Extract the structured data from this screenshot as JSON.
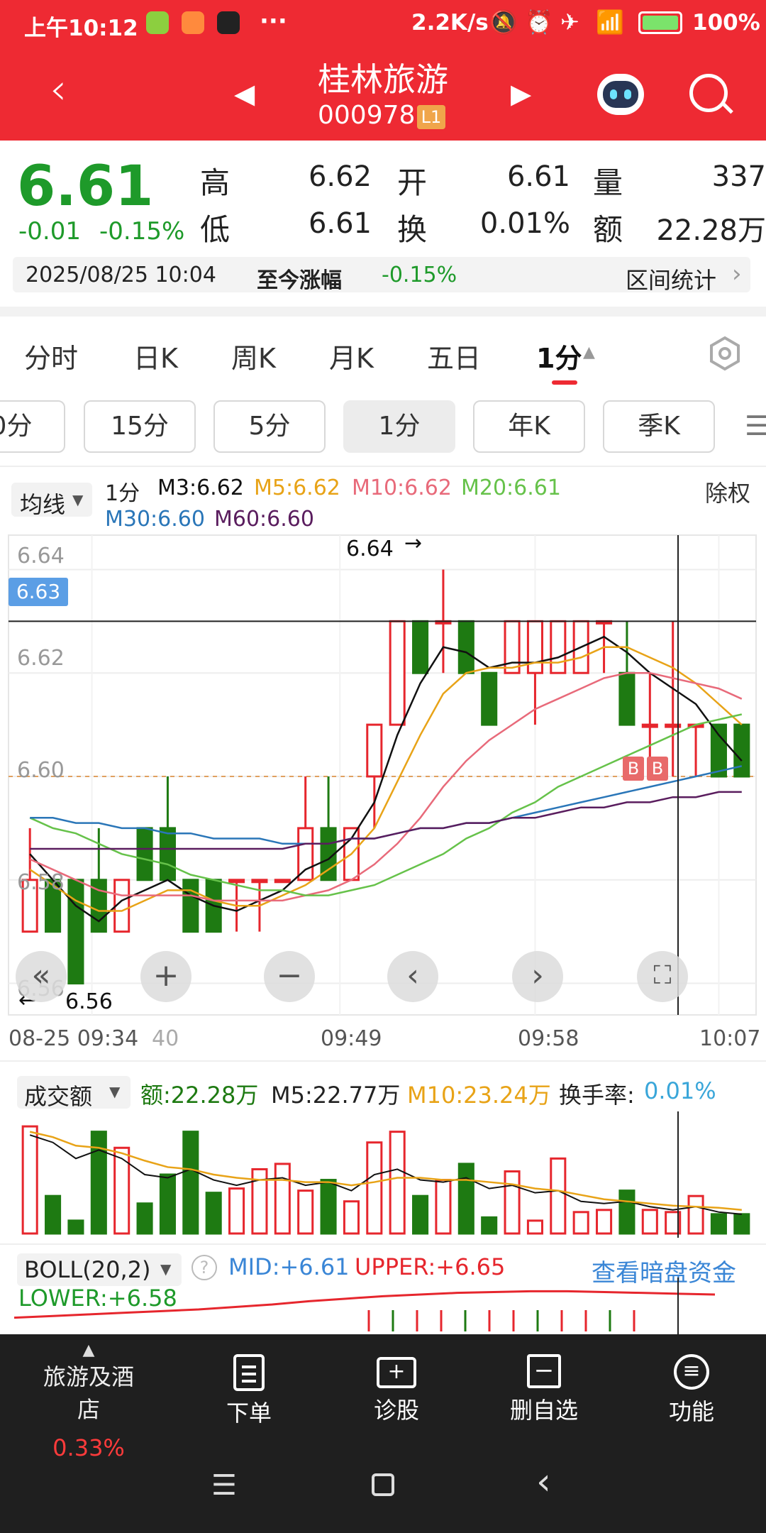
{
  "status_bar": {
    "time": "上午10:12",
    "net_speed": "2.2K/s",
    "battery": "100%"
  },
  "header": {
    "stock_name": "桂林旅游",
    "stock_code": "000978",
    "level_badge": "L1"
  },
  "quote": {
    "price": "6.61",
    "change": "-0.01",
    "change_pct": "-0.15%",
    "high_label": "高",
    "high": "6.62",
    "open_label": "开",
    "open": "6.61",
    "volume_label": "量",
    "volume": "337",
    "low_label": "低",
    "low": "6.61",
    "turnover_label": "换",
    "turnover": "0.01%",
    "amount_label": "额",
    "amount": "22.28万",
    "datetime": "2025/08/25 10:04",
    "since_label": "至今涨幅",
    "since_value": "-0.15%",
    "range_stats": "区间统计"
  },
  "tabs": [
    "分时",
    "日K",
    "周K",
    "月K",
    "五日",
    "1分"
  ],
  "period_buttons": [
    "0分",
    "15分",
    "5分",
    "1分",
    "年K",
    "季K"
  ],
  "ma_legend": {
    "selector": "均线",
    "period": "1分",
    "m3": "M3:6.62",
    "m5": "M5:6.62",
    "m10": "M10:6.62",
    "m20": "M20:6.61",
    "m30": "M30:6.60",
    "m60": "M60:6.60",
    "rights": "除权"
  },
  "main_chart_labels": {
    "y_ticks": [
      "6.64",
      "6.62",
      "6.60",
      "6.58",
      "6.56"
    ],
    "crosshair_price": "6.63",
    "high_marker": "6.64",
    "low_marker": "6.56",
    "x_ticks": [
      "08-25 09:34",
      "40",
      "09:49",
      "09:58",
      "10:07"
    ],
    "b_marks": [
      "B",
      "B"
    ]
  },
  "volume_legend": {
    "selector": "成交额",
    "amount": "额:22.28万",
    "m5": "M5:22.77万",
    "m10": "M10:23.24万",
    "turnover_label": "换手率:",
    "turnover_value": "0.01%"
  },
  "boll_legend": {
    "selector": "BOLL(20,2)",
    "mid": "MID:+6.61",
    "upper": "UPPER:+6.65",
    "lower": "LOWER:+6.58",
    "dark_pool": "查看暗盘资金"
  },
  "bottom_nav": {
    "sector": "旅游及酒店",
    "sector_change": "0.33%",
    "items": [
      "下单",
      "诊股",
      "删自选",
      "功能"
    ]
  },
  "colors": {
    "red": "#e6262d",
    "green": "#1e7a12",
    "header": "#ee2a33",
    "m5": "#e8a317",
    "m10": "#e86a7a",
    "m20": "#66c24a",
    "m30": "#2a76b8",
    "m60": "#5a1d5e"
  },
  "chart_data": {
    "type": "candlestick",
    "ylim": [
      6.555,
      6.645
    ],
    "candles": [
      {
        "o": 6.57,
        "c": 6.58,
        "h": 6.59,
        "l": 6.57
      },
      {
        "o": 6.58,
        "c": 6.57,
        "h": 6.58,
        "l": 6.57
      },
      {
        "o": 6.58,
        "c": 6.56,
        "h": 6.58,
        "l": 6.56
      },
      {
        "o": 6.58,
        "c": 6.57,
        "h": 6.59,
        "l": 6.57
      },
      {
        "o": 6.57,
        "c": 6.58,
        "h": 6.58,
        "l": 6.57
      },
      {
        "o": 6.59,
        "c": 6.58,
        "h": 6.59,
        "l": 6.58
      },
      {
        "o": 6.59,
        "c": 6.58,
        "h": 6.6,
        "l": 6.58
      },
      {
        "o": 6.58,
        "c": 6.57,
        "h": 6.58,
        "l": 6.57
      },
      {
        "o": 6.58,
        "c": 6.57,
        "h": 6.58,
        "l": 6.57
      },
      {
        "o": 6.58,
        "c": 6.58,
        "h": 6.58,
        "l": 6.57
      },
      {
        "o": 6.58,
        "c": 6.58,
        "h": 6.58,
        "l": 6.57
      },
      {
        "o": 6.58,
        "c": 6.58,
        "h": 6.58,
        "l": 6.58
      },
      {
        "o": 6.58,
        "c": 6.59,
        "h": 6.6,
        "l": 6.58
      },
      {
        "o": 6.59,
        "c": 6.58,
        "h": 6.6,
        "l": 6.58
      },
      {
        "o": 6.58,
        "c": 6.59,
        "h": 6.59,
        "l": 6.58
      },
      {
        "o": 6.6,
        "c": 6.61,
        "h": 6.61,
        "l": 6.59
      },
      {
        "o": 6.61,
        "c": 6.63,
        "h": 6.63,
        "l": 6.61
      },
      {
        "o": 6.63,
        "c": 6.62,
        "h": 6.63,
        "l": 6.62
      },
      {
        "o": 6.63,
        "c": 6.63,
        "h": 6.64,
        "l": 6.62
      },
      {
        "o": 6.63,
        "c": 6.62,
        "h": 6.63,
        "l": 6.62
      },
      {
        "o": 6.62,
        "c": 6.61,
        "h": 6.62,
        "l": 6.61
      },
      {
        "o": 6.62,
        "c": 6.63,
        "h": 6.63,
        "l": 6.62
      },
      {
        "o": 6.62,
        "c": 6.63,
        "h": 6.63,
        "l": 6.61
      },
      {
        "o": 6.62,
        "c": 6.63,
        "h": 6.63,
        "l": 6.62
      },
      {
        "o": 6.62,
        "c": 6.63,
        "h": 6.63,
        "l": 6.62
      },
      {
        "o": 6.63,
        "c": 6.63,
        "h": 6.63,
        "l": 6.62
      },
      {
        "o": 6.62,
        "c": 6.61,
        "h": 6.63,
        "l": 6.61
      },
      {
        "o": 6.61,
        "c": 6.61,
        "h": 6.62,
        "l": 6.6
      },
      {
        "o": 6.61,
        "c": 6.61,
        "h": 6.63,
        "l": 6.6
      },
      {
        "o": 6.61,
        "c": 6.61,
        "h": 6.61,
        "l": 6.6
      },
      {
        "o": 6.61,
        "c": 6.6,
        "h": 6.61,
        "l": 6.6
      },
      {
        "o": 6.61,
        "c": 6.6,
        "h": 6.61,
        "l": 6.6
      }
    ],
    "series": [
      {
        "name": "M3",
        "values": [
          6.585,
          6.58,
          6.575,
          6.572,
          6.576,
          6.578,
          6.58,
          6.577,
          6.575,
          6.574,
          6.576,
          6.578,
          6.582,
          6.584,
          6.588,
          6.595,
          6.608,
          6.618,
          6.625,
          6.624,
          6.621,
          6.622,
          6.622,
          6.623,
          6.625,
          6.627,
          6.624,
          6.62,
          6.617,
          6.614,
          6.608,
          6.603
        ]
      },
      {
        "name": "M5",
        "values": [
          6.582,
          6.579,
          6.576,
          6.574,
          6.574,
          6.576,
          6.578,
          6.578,
          6.576,
          6.575,
          6.575,
          6.577,
          6.579,
          6.582,
          6.585,
          6.59,
          6.599,
          6.608,
          6.616,
          6.62,
          6.621,
          6.621,
          6.622,
          6.622,
          6.623,
          6.625,
          6.625,
          6.623,
          6.621,
          6.618,
          6.614,
          6.61
        ]
      },
      {
        "name": "M10",
        "values": [
          6.584,
          6.582,
          6.58,
          6.578,
          6.577,
          6.577,
          6.577,
          6.577,
          6.576,
          6.576,
          6.576,
          6.576,
          6.577,
          6.578,
          6.58,
          6.583,
          6.587,
          6.592,
          6.598,
          6.603,
          6.607,
          6.61,
          6.613,
          6.615,
          6.617,
          6.619,
          6.62,
          6.62,
          6.619,
          6.618,
          6.617,
          6.615
        ]
      },
      {
        "name": "M20",
        "values": [
          6.592,
          6.59,
          6.589,
          6.587,
          6.585,
          6.584,
          6.583,
          6.581,
          6.58,
          6.579,
          6.578,
          6.578,
          6.577,
          6.577,
          6.578,
          6.579,
          6.581,
          6.583,
          6.585,
          6.588,
          6.59,
          6.593,
          6.595,
          6.598,
          6.6,
          6.602,
          6.604,
          6.606,
          6.608,
          6.61,
          6.611,
          6.612
        ]
      },
      {
        "name": "M30",
        "values": [
          6.592,
          6.592,
          6.591,
          6.591,
          6.59,
          6.59,
          6.589,
          6.589,
          6.588,
          6.588,
          6.588,
          6.587,
          6.587,
          6.587,
          6.588,
          6.588,
          6.589,
          6.59,
          6.59,
          6.591,
          6.591,
          6.592,
          6.593,
          6.594,
          6.595,
          6.596,
          6.597,
          6.598,
          6.599,
          6.6,
          6.601,
          6.602
        ]
      },
      {
        "name": "M60",
        "values": [
          6.586,
          6.586,
          6.586,
          6.586,
          6.586,
          6.586,
          6.586,
          6.586,
          6.586,
          6.586,
          6.586,
          6.586,
          6.587,
          6.587,
          6.588,
          6.588,
          6.589,
          6.59,
          6.59,
          6.591,
          6.591,
          6.592,
          6.592,
          6.593,
          6.594,
          6.594,
          6.595,
          6.595,
          6.596,
          6.596,
          6.597,
          6.597
        ]
      }
    ],
    "volume": {
      "values": [
        100,
        35,
        12,
        95,
        80,
        28,
        55,
        95,
        38,
        42,
        60,
        65,
        40,
        50,
        30,
        85,
        95,
        35,
        50,
        65,
        15,
        58,
        12,
        70,
        20,
        22,
        40,
        22,
        20,
        35,
        18,
        18
      ],
      "m5": [
        92,
        85,
        70,
        78,
        70,
        55,
        52,
        60,
        50,
        45,
        50,
        52,
        45,
        48,
        40,
        55,
        60,
        50,
        48,
        52,
        42,
        45,
        38,
        40,
        30,
        28,
        30,
        25,
        22,
        25,
        20,
        18
      ],
      "m10": [
        95,
        90,
        82,
        80,
        75,
        68,
        62,
        60,
        55,
        52,
        50,
        50,
        48,
        48,
        45,
        48,
        52,
        52,
        50,
        50,
        48,
        46,
        42,
        40,
        36,
        32,
        30,
        28,
        26,
        25,
        24,
        22
      ]
    },
    "boll": {
      "upper": [
        6.62,
        6.622,
        6.624,
        6.626,
        6.628,
        6.63,
        6.633,
        6.636,
        6.64,
        6.643,
        6.646,
        6.648,
        6.65,
        6.651,
        6.652,
        6.652,
        6.651,
        6.65,
        6.649,
        6.648
      ],
      "mid": [
        6.595,
        6.594,
        6.593,
        6.592,
        6.591,
        6.59,
        6.59,
        6.591,
        6.593,
        6.596,
        6.599,
        6.602,
        6.605,
        6.607,
        6.608,
        6.609,
        6.61,
        6.61,
        6.611,
        6.611
      ]
    }
  }
}
